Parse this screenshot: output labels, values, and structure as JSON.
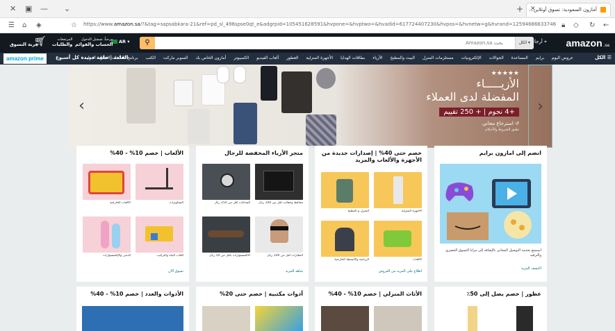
{
  "browser": {
    "tab_title": "أمازون السعودية: تسوق أونلاين...",
    "url_prefix": "https://www.",
    "url_domain": "amazon.sa",
    "url_rest": "/?&tag=sapsabkara-21&ref=pd_sl_496spse0qt_e&adgrpid=105451628591&hvpone=&hvptwo=&hvadid=617724407230&hvpos=&hvnetw=g&hvrand=12594686633746955480&hvqmt=e&hvdev=c&hvdvcmdl=&hvlocint=&hvlocphy=9061564&hvtargid=kwd-10573980&hydadcr=19130_2132413"
  },
  "header": {
    "logo": "amazon",
    "logo_tld": ".sa",
    "deliver_line": "توصيل إلى الرياض",
    "deliver_sub": "أرجاء تغيير عنوانك",
    "search_placeholder": "Amazon.sa بحث",
    "search_category": "الكل",
    "lang": "AR",
    "account_line": "مرحباً، تسجيل الدخول",
    "account_sub": "الحساب والقوائم",
    "returns_line": "المرتجعات",
    "returns_sub": "والطلبات",
    "cart_label": "عربة التسوق"
  },
  "nav": {
    "all": "الكل",
    "items": [
      "عروض اليوم",
      "برايم",
      "المساعدة",
      "الجوالات",
      "الإلكترونيات",
      "مستلزمات المنزل",
      "البيت والمطبخ",
      "الأزياء",
      "بطاقات الهدايا",
      "الأجهزة المنزلية",
      "العطور",
      "ألعاب الفيديو",
      "الكمبيوتر",
      "أمازون الخاص بك",
      "السوبر ماركت",
      "الكتب",
      "برنامج العلامات التجارية الدولية"
    ],
    "promo": "القلعة | حلقة جديدة كل أسبوع",
    "prime": "amazon prime"
  },
  "hero": {
    "stars": "★★★★★",
    "title_1": "الأزيـــــاء",
    "title_2": "المفضلة لدى العملاء",
    "badge": "+4 نجوم | + 250 تقييم",
    "free_return": "استرجاع مجاني",
    "note": "تطبق الشروط والأحكام"
  },
  "cards": [
    {
      "title": "انضم إلى امازون برايم",
      "blurb": "استمتع بخدمة التوصيل المجاني بالإضافة إلى مزايا التسوق الحصري والترفيه",
      "more": "اكتشف المزيد"
    },
    {
      "title": "خصم حتى 40% | إصدارات جديدة من الأجهزة والألعاب والمزيد",
      "tiles": [
        "الأجهزة المنزلية",
        "المنزل و المطبخ",
        "الألعاب",
        "الرياضة والأنشطة الخارجية"
      ],
      "more": "اطلاع على المزيد من العروض"
    },
    {
      "title": "متجر الأزياء المخفضة للرجال",
      "tiles": [
        "محافظ وحقائب أقل من 100 ريال",
        "الساعات أقل من 250 ريال",
        "النظارات أقل من 100 ريال",
        "الاكسسوارات بأقل من 50 ريال"
      ],
      "more": "شاهد المزيد"
    },
    {
      "title": "الألعاب | خصم 10% - 40%",
      "tiles": [
        "السكوترات",
        "الألعاب الخارجية",
        "ألعاب البناء والتركيب",
        "الدمى والإكسسوارات"
      ],
      "more": "تسوق الآن"
    }
  ],
  "cards_row2": [
    {
      "title": "عطور | خصم يصل إلى 50٪"
    },
    {
      "title": "الأثاث المنزلي | خصم 10% - 40%"
    },
    {
      "title": "أدوات مكتبية | خصم حتى 20%"
    },
    {
      "title": "الأدوات والعدد | خصم 10% - 40%"
    }
  ]
}
